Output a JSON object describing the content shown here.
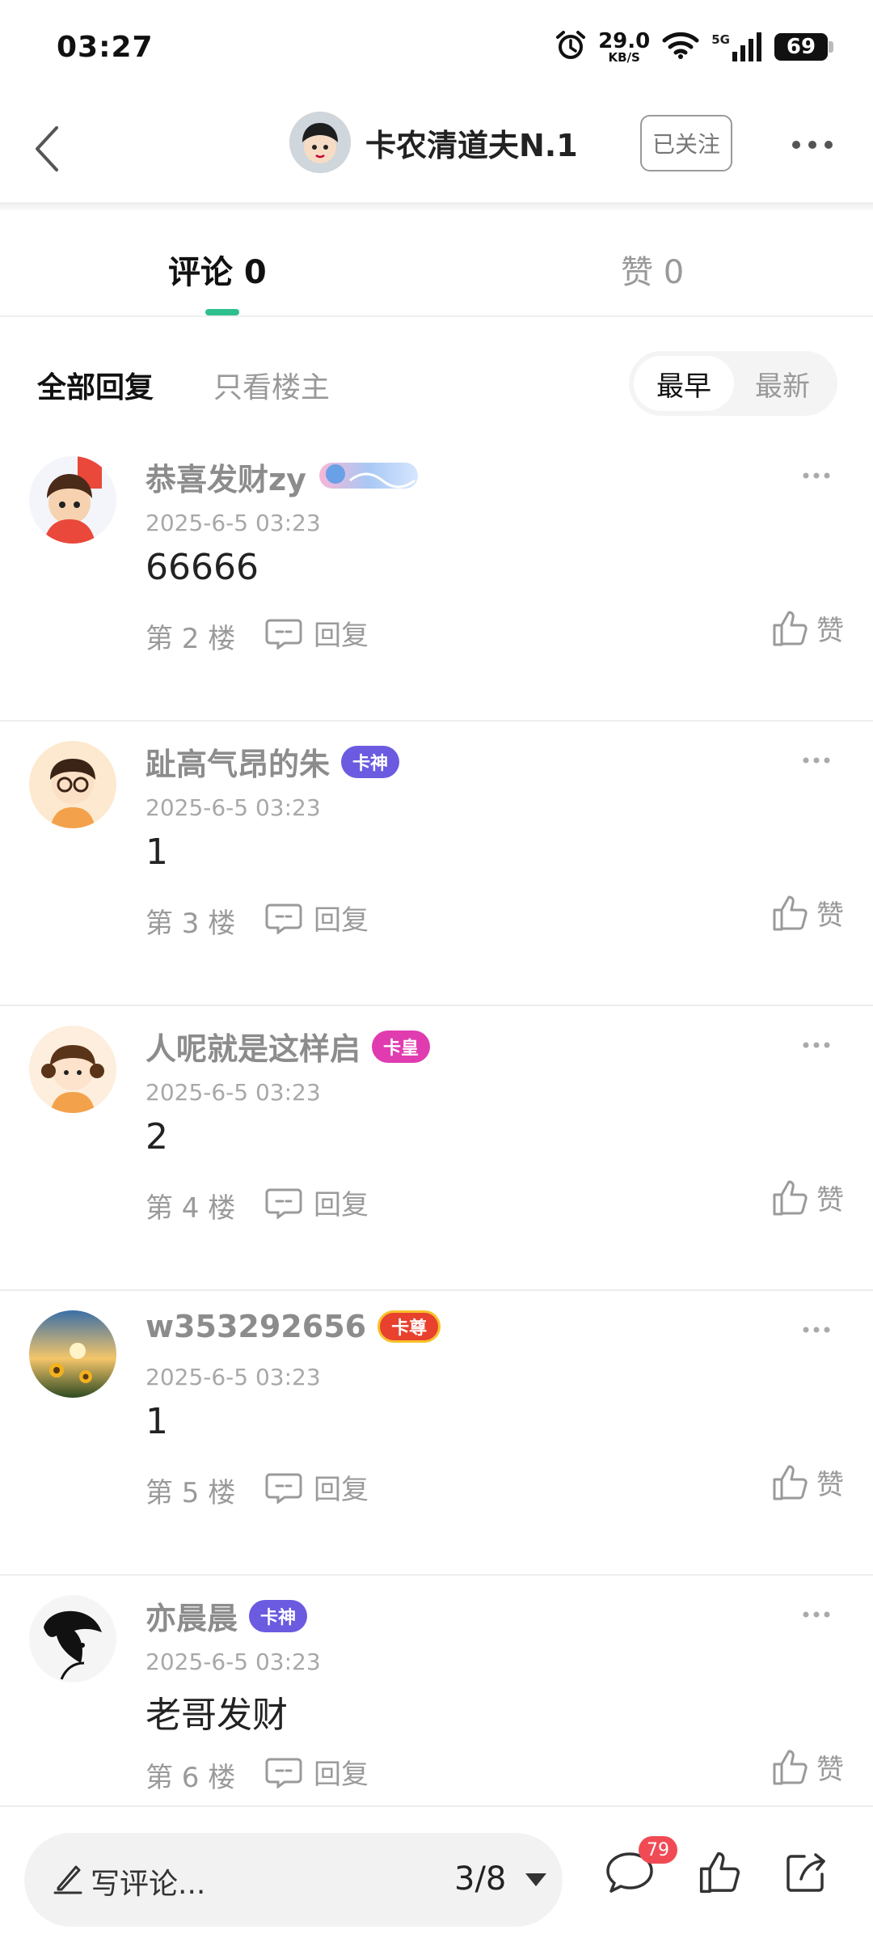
{
  "status_bar": {
    "time": "03:27",
    "net_speed": "29.0",
    "net_unit": "KB/S",
    "network_type": "5G",
    "battery": "69"
  },
  "header": {
    "user_name": "卡农清道夫N.1",
    "follow_label": "已关注"
  },
  "tabs": {
    "comments_label": "评论 0",
    "likes_label": "赞 0"
  },
  "filter": {
    "all_label": "全部回复",
    "op_only_label": "只看楼主",
    "sort_earliest": "最早",
    "sort_newest": "最新"
  },
  "comments": [
    {
      "user": "恭喜发财zy",
      "badge": "",
      "badge_color": "#9ab6f0",
      "time": "2025-6-5 03:23",
      "text": "66666",
      "floor": "第 2 楼",
      "reply_label": "回复",
      "like_label": "赞",
      "avatar_color": "#e9483b"
    },
    {
      "user": "趾高气昂的朱",
      "badge": "卡神",
      "badge_color": "#6a5be0",
      "time": "2025-6-5 03:23",
      "text": "1",
      "floor": "第 3 楼",
      "reply_label": "回复",
      "like_label": "赞",
      "avatar_color": "#f7e2c4"
    },
    {
      "user": "人呢就是这样启",
      "badge": "卡皇",
      "badge_color": "#e03cb0",
      "time": "2025-6-5 03:23",
      "text": "2",
      "floor": "第 4 楼",
      "reply_label": "回复",
      "like_label": "赞",
      "avatar_color": "#fbe5cf"
    },
    {
      "user": "w353292656",
      "badge": "卡尊",
      "badge_color": "#e8412e",
      "time": "2025-6-5 03:23",
      "text": "1",
      "floor": "第 5 楼",
      "reply_label": "回复",
      "like_label": "赞",
      "avatar_color": "#3a5a86"
    },
    {
      "user": "亦晨晨",
      "badge": "卡神",
      "badge_color": "#6a5be0",
      "time": "2025-6-5 03:23",
      "text": "老哥发财",
      "floor": "第 6 楼",
      "reply_label": "回复",
      "like_label": "赞",
      "avatar_color": "#f2f2f2"
    }
  ],
  "bottom_bar": {
    "write_placeholder": "写评论...",
    "page_indicator": "3/8",
    "comment_count": "79"
  },
  "colors": {
    "accent": "#2ebf8f",
    "badge_red": "#f04b55"
  }
}
